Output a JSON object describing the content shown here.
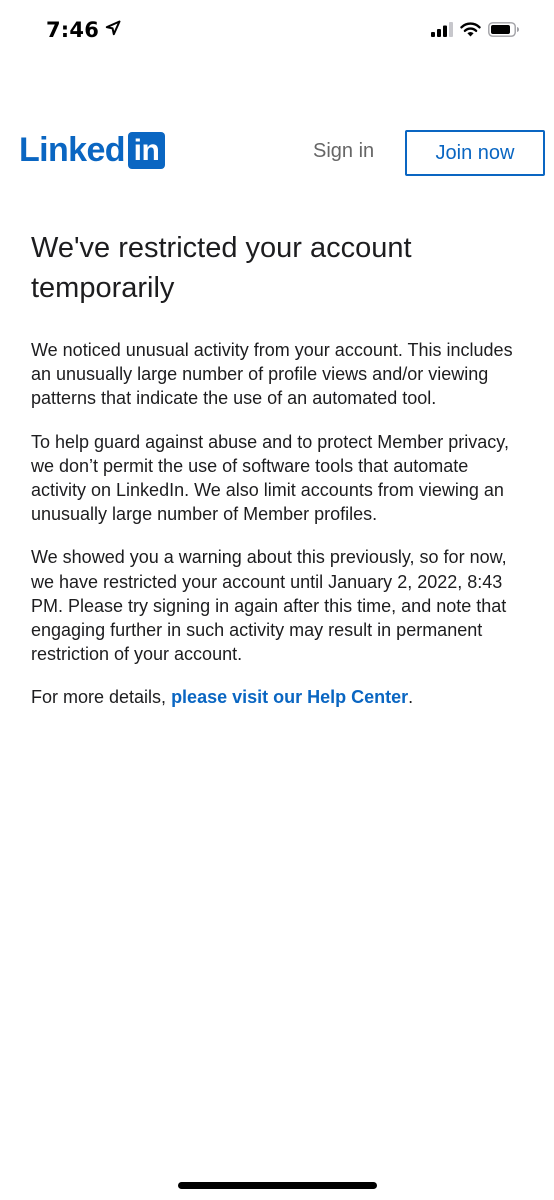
{
  "status_bar": {
    "time": "7:46"
  },
  "header": {
    "logo_text": "Linked",
    "logo_box_text": "in",
    "sign_in_label": "Sign in",
    "join_now_label": "Join now"
  },
  "main": {
    "title": "We've restricted your account temporarily",
    "paragraphs": [
      "We noticed unusual activity from your account. This includes an unusually large number of profile views and/or viewing patterns that indicate the use of an automated tool.",
      "To help guard against abuse and to protect Member privacy, we don’t permit the use of software tools that automate activity on LinkedIn. We also limit accounts from viewing an unusually large number of Member profiles.",
      "We showed you a warning about this previously, so for now, we have restricted your account until January 2, 2022, 8:43 PM. Please try signing in again after this time, and note that engaging further in such activity may result in permanent restriction of your account."
    ],
    "details_prefix": "For more details,",
    "help_link_label": "please visit our Help Center",
    "details_suffix": "."
  },
  "colors": {
    "brand": "#0a66c2",
    "text": "#1d1d1f",
    "muted": "#666666"
  },
  "icons": {
    "location": "location-arrow-icon",
    "signal": "cellular-signal-icon",
    "wifi": "wifi-icon",
    "battery": "battery-icon"
  }
}
